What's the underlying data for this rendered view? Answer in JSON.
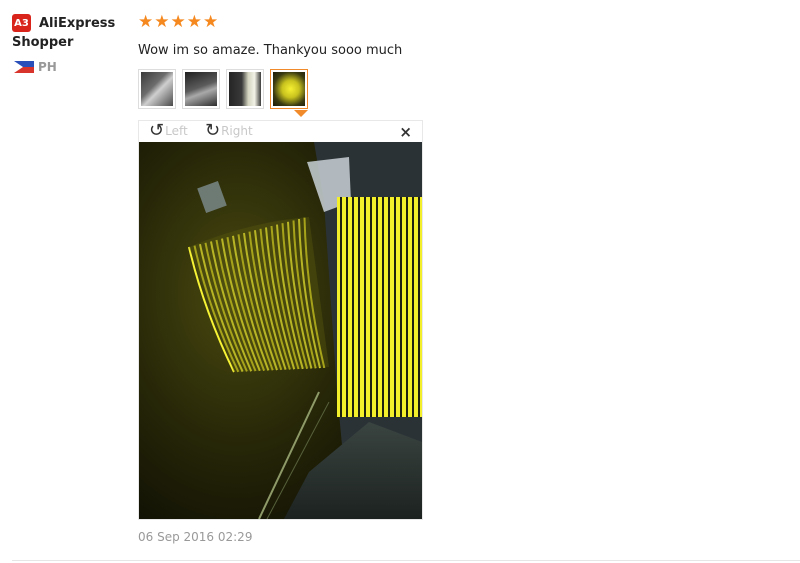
{
  "review": {
    "avatar_badge": "A3",
    "user_name": "AliExpress Shopper",
    "country_code": "PH",
    "rating": 5,
    "star_glyph": "★",
    "text": "Wow im so amaze. Thankyou sooo much",
    "date": "06 Sep 2016 02:29",
    "thumbnails": [
      "photo-1",
      "photo-2",
      "photo-3",
      "photo-4"
    ],
    "active_thumbnail": 4
  },
  "viewer": {
    "rotate_left_label": "Left",
    "rotate_right_label": "Right",
    "rotate_left_icon": "↺",
    "rotate_right_icon": "↻",
    "close_icon": "×"
  },
  "colors": {
    "star": "#f5891f",
    "badge": "#d9241b",
    "active_border": "#f08a2a"
  }
}
